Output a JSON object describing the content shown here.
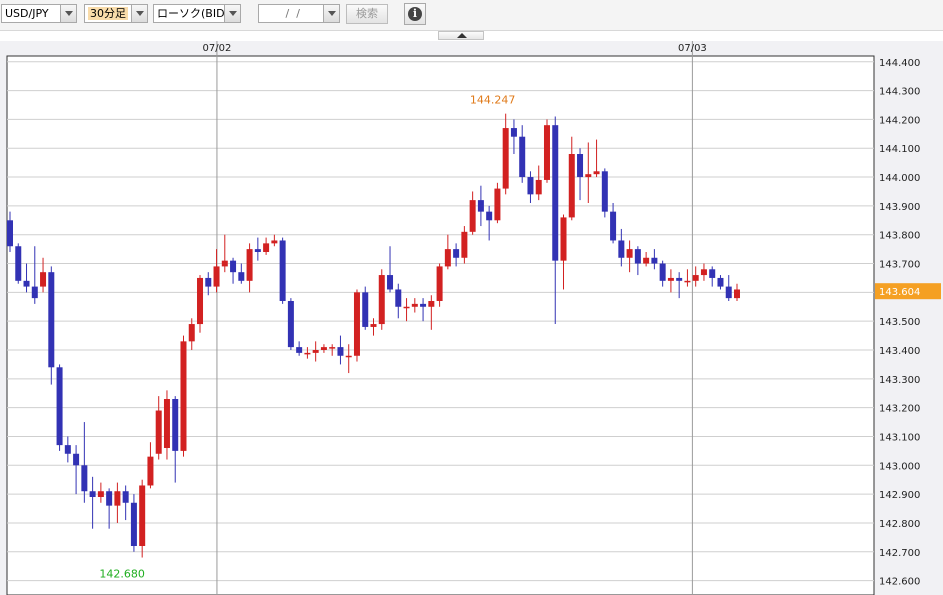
{
  "toolbar": {
    "pair": "USD/JPY",
    "interval": "30分足",
    "chart_style": "ローソク(BID)",
    "date_input": " /  /",
    "search_label": "検索",
    "info_symbol": "i"
  },
  "colors": {
    "up": "#d22121",
    "down": "#3232b4",
    "high_label": "#e07a1a",
    "low_label": "#1fae1f",
    "current_bg": "#f5a023",
    "grid": "#cfcfcf",
    "vline": "#9a9a9a"
  },
  "chart_data": {
    "type": "candlestick",
    "x_labels": [
      "07/02",
      "07/03"
    ],
    "ylim": [
      142.55,
      144.42
    ],
    "y_ticks": [
      "144.400",
      "144.300",
      "144.200",
      "144.100",
      "144.000",
      "143.900",
      "143.800",
      "143.700",
      "143.600",
      "143.500",
      "143.400",
      "143.300",
      "143.200",
      "143.100",
      "143.000",
      "142.900",
      "142.800",
      "142.700",
      "142.600"
    ],
    "high_annotation": "144.247",
    "low_annotation": "142.680",
    "current_price": "143.604",
    "candles": [
      [
        143.85,
        143.76,
        143.88,
        143.74
      ],
      [
        143.76,
        143.64,
        143.77,
        143.63
      ],
      [
        143.64,
        143.62,
        143.7,
        143.6
      ],
      [
        143.62,
        143.58,
        143.76,
        143.56
      ],
      [
        143.62,
        143.67,
        143.72,
        143.6
      ],
      [
        143.67,
        143.34,
        143.69,
        143.28
      ],
      [
        143.34,
        143.07,
        143.35,
        143.05
      ],
      [
        143.07,
        143.04,
        143.1,
        143.01
      ],
      [
        143.04,
        143.0,
        143.07,
        142.9
      ],
      [
        143.0,
        142.91,
        143.15,
        142.87
      ],
      [
        142.91,
        142.89,
        142.96,
        142.78
      ],
      [
        142.89,
        142.91,
        142.94,
        142.87
      ],
      [
        142.91,
        142.86,
        142.92,
        142.78
      ],
      [
        142.86,
        142.91,
        142.94,
        142.8
      ],
      [
        142.91,
        142.87,
        142.93,
        142.81
      ],
      [
        142.87,
        142.72,
        142.9,
        142.7
      ],
      [
        142.72,
        142.93,
        142.95,
        142.68
      ],
      [
        142.93,
        143.03,
        143.08,
        142.92
      ],
      [
        143.04,
        143.19,
        143.24,
        143.02
      ],
      [
        143.06,
        143.23,
        143.26,
        143.02
      ],
      [
        143.23,
        143.05,
        143.24,
        142.94
      ],
      [
        143.05,
        143.43,
        143.45,
        143.03
      ],
      [
        143.43,
        143.49,
        143.51,
        143.4
      ],
      [
        143.49,
        143.65,
        143.66,
        143.46
      ],
      [
        143.65,
        143.62,
        143.67,
        143.59
      ],
      [
        143.62,
        143.69,
        143.75,
        143.6
      ],
      [
        143.69,
        143.71,
        143.8,
        143.67
      ],
      [
        143.71,
        143.67,
        143.72,
        143.63
      ],
      [
        143.67,
        143.64,
        143.7,
        143.63
      ],
      [
        143.64,
        143.75,
        143.77,
        143.6
      ],
      [
        143.75,
        143.74,
        143.79,
        143.71
      ],
      [
        143.74,
        143.77,
        143.79,
        143.73
      ],
      [
        143.77,
        143.78,
        143.8,
        143.76
      ],
      [
        143.78,
        143.57,
        143.79,
        143.56
      ],
      [
        143.57,
        143.41,
        143.58,
        143.4
      ],
      [
        143.41,
        143.39,
        143.43,
        143.38
      ],
      [
        143.39,
        143.39,
        143.41,
        143.37
      ],
      [
        143.39,
        143.4,
        143.43,
        143.36
      ],
      [
        143.4,
        143.41,
        143.42,
        143.39
      ],
      [
        143.41,
        143.41,
        143.42,
        143.38
      ],
      [
        143.41,
        143.38,
        143.45,
        143.35
      ],
      [
        143.38,
        143.38,
        143.42,
        143.32
      ],
      [
        143.38,
        143.6,
        143.61,
        143.36
      ],
      [
        143.6,
        143.48,
        143.62,
        143.47
      ],
      [
        143.48,
        143.49,
        143.51,
        143.45
      ],
      [
        143.49,
        143.66,
        143.68,
        143.47
      ],
      [
        143.66,
        143.61,
        143.76,
        143.6
      ],
      [
        143.61,
        143.55,
        143.63,
        143.51
      ],
      [
        143.55,
        143.55,
        143.58,
        143.5
      ],
      [
        143.55,
        143.56,
        143.58,
        143.53
      ],
      [
        143.56,
        143.55,
        143.58,
        143.5
      ],
      [
        143.55,
        143.57,
        143.59,
        143.47
      ],
      [
        143.57,
        143.69,
        143.7,
        143.55
      ],
      [
        143.69,
        143.75,
        143.8,
        143.68
      ],
      [
        143.75,
        143.72,
        143.77,
        143.69
      ],
      [
        143.72,
        143.81,
        143.83,
        143.7
      ],
      [
        143.81,
        143.92,
        143.95,
        143.8
      ],
      [
        143.92,
        143.88,
        143.97,
        143.83
      ],
      [
        143.88,
        143.85,
        143.9,
        143.78
      ],
      [
        143.85,
        143.96,
        143.98,
        143.84
      ],
      [
        143.96,
        144.17,
        144.22,
        143.94
      ],
      [
        144.17,
        144.14,
        144.2,
        144.08
      ],
      [
        144.14,
        144.0,
        144.18,
        143.98
      ],
      [
        144.0,
        143.94,
        144.02,
        143.91
      ],
      [
        143.94,
        143.99,
        144.04,
        143.92
      ],
      [
        143.99,
        144.18,
        144.2,
        143.98
      ],
      [
        144.18,
        143.71,
        144.21,
        143.49
      ],
      [
        143.71,
        143.86,
        143.87,
        143.61
      ],
      [
        143.86,
        144.08,
        144.14,
        143.85
      ],
      [
        144.08,
        144.0,
        144.1,
        143.92
      ],
      [
        144.0,
        144.01,
        144.12,
        143.91
      ],
      [
        144.01,
        144.02,
        144.13,
        144.0
      ],
      [
        144.02,
        143.88,
        144.03,
        143.86
      ],
      [
        143.88,
        143.78,
        143.91,
        143.77
      ],
      [
        143.78,
        143.72,
        143.82,
        143.69
      ],
      [
        143.72,
        143.75,
        143.78,
        143.67
      ],
      [
        143.75,
        143.7,
        143.76,
        143.66
      ],
      [
        143.7,
        143.72,
        143.74,
        143.69
      ],
      [
        143.72,
        143.7,
        143.75,
        143.68
      ],
      [
        143.7,
        143.64,
        143.71,
        143.62
      ],
      [
        143.64,
        143.65,
        143.68,
        143.6
      ],
      [
        143.65,
        143.64,
        143.67,
        143.58
      ],
      [
        143.64,
        143.64,
        143.68,
        143.62
      ],
      [
        143.64,
        143.66,
        143.69,
        143.62
      ],
      [
        143.66,
        143.68,
        143.7,
        143.64
      ],
      [
        143.68,
        143.65,
        143.69,
        143.62
      ],
      [
        143.65,
        143.62,
        143.66,
        143.61
      ],
      [
        143.62,
        143.58,
        143.66,
        143.57
      ],
      [
        143.58,
        143.61,
        143.63,
        143.57
      ]
    ]
  }
}
